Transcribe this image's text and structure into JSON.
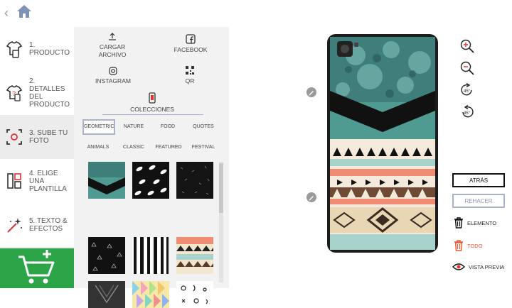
{
  "nav": {
    "steps": [
      {
        "label": "1. PRODUCTO"
      },
      {
        "label": "2. DETALLES DEL PRODUCTO"
      },
      {
        "label": "3. SUBE TU FOTO"
      },
      {
        "label": "4. ELIGE UNA PLANTILLA"
      },
      {
        "label": "5. TEXTO & EFECTOS"
      }
    ]
  },
  "upload": {
    "upload_label": "CARGAR ARCHIVO",
    "facebook_label": "FACEBOOK",
    "instagram_label": "INSTAGRAM",
    "qr_label": "QR",
    "collections_label": "COLECCIONES"
  },
  "categories": {
    "row1": [
      "GEOMETRIC",
      "NATURE",
      "FOOD",
      "QUOTES"
    ],
    "row2": [
      "ANIMALS",
      "CLASSIC",
      "FEATURED",
      "FESTIVAL"
    ],
    "selected": "GEOMETRIC"
  },
  "actions": {
    "back_label": "ATRÁS",
    "redo_label": "REHACER",
    "element_label": "ELEMENTO",
    "all_label": "TODO",
    "preview_label": "VISTA PREVIA"
  },
  "colors": {
    "accent_green": "#2ca548",
    "teal": "#4f9a91",
    "salmon": "#f08c73",
    "todo_red": "#e8572e",
    "redo_border": "#aab3c9"
  },
  "icons": {
    "home": "home-icon",
    "zoom_in": "zoom-in-icon",
    "zoom_out": "zoom-out-icon",
    "rotate_cw": "rotate-right-45-icon",
    "rotate_ccw": "rotate-left-45-icon",
    "trash": "trash-icon",
    "eye": "eye-icon"
  }
}
